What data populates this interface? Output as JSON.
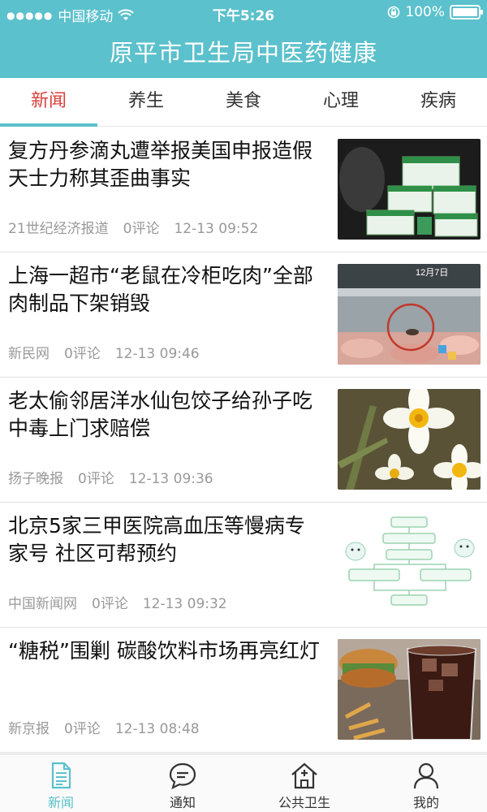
{
  "status_bar": {
    "carrier": "中国移动",
    "time": "下午5:26",
    "battery": "100%",
    "battery_level": 1.0
  },
  "header": {
    "title": "原平市卫生局中医药健康"
  },
  "tabs": [
    {
      "label": "新闻",
      "active": true
    },
    {
      "label": "养生",
      "active": false
    },
    {
      "label": "美食",
      "active": false
    },
    {
      "label": "心理",
      "active": false
    },
    {
      "label": "疾病",
      "active": false
    }
  ],
  "news": [
    {
      "title": "复方丹参滴丸遭举报美国申报造假 天士力称其歪曲事实",
      "source": "21世纪经济报道",
      "comments": "0评论",
      "time": "12-13 09:52",
      "thumb_icon": "medicine-boxes-image"
    },
    {
      "title": "上海一超市“老鼠在冷柜吃肉”全部肉制品下架销毁",
      "source": "新民网",
      "comments": "0评论",
      "time": "12-13 09:46",
      "thumb_icon": "supermarket-freezer-image",
      "thumb_caption": "12月7日"
    },
    {
      "title": "老太偷邻居洋水仙包饺子给孙子吃 中毒上门求赔偿",
      "source": "扬子晚报",
      "comments": "0评论",
      "time": "12-13 09:36",
      "thumb_icon": "daffodil-flower-image"
    },
    {
      "title": "北京5家三甲医院高血压等慢病专家号 社区可帮预约",
      "source": "中国新闻网",
      "comments": "0评论",
      "time": "12-13 09:32",
      "thumb_icon": "appointment-flowchart-image"
    },
    {
      "title": "“糖税”围剿 碳酸饮料市场再亮红灯",
      "source": "新京报",
      "comments": "0评论",
      "time": "12-13 08:48",
      "thumb_icon": "soda-drink-image"
    }
  ],
  "bottom_nav": [
    {
      "label": "新闻",
      "icon": "document-icon",
      "active": true
    },
    {
      "label": "通知",
      "icon": "chat-bubble-icon",
      "active": false
    },
    {
      "label": "公共卫生",
      "icon": "house-plus-icon",
      "active": false
    },
    {
      "label": "我的",
      "icon": "person-icon",
      "active": false
    }
  ],
  "colors": {
    "accent": "#5bc1cc",
    "active_tab_text": "#d9403a",
    "meta_text": "#999999"
  }
}
